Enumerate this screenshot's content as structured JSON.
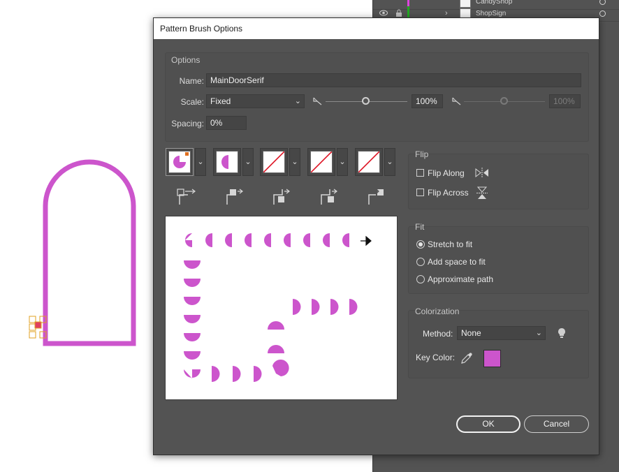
{
  "dialog": {
    "title": "Pattern Brush Options"
  },
  "options": {
    "group_label": "Options",
    "name_label": "Name:",
    "name_value": "MainDoorSerif",
    "scale_label": "Scale:",
    "scale_value": "Fixed",
    "scale_min": "100%",
    "scale_max": "100%",
    "spacing_label": "Spacing:",
    "spacing_value": "0%"
  },
  "tiles": [
    {
      "name": "side-tile",
      "selected": true
    },
    {
      "name": "outer-corner-tile",
      "selected": false
    },
    {
      "name": "inner-corner-tile",
      "selected": false
    },
    {
      "name": "start-tile",
      "selected": false
    },
    {
      "name": "end-tile",
      "selected": false
    }
  ],
  "flip": {
    "group_label": "Flip",
    "along_label": "Flip Along",
    "across_label": "Flip Across",
    "along_checked": false,
    "across_checked": false
  },
  "fit": {
    "group_label": "Fit",
    "options": [
      "Stretch to fit",
      "Add space to fit",
      "Approximate path"
    ],
    "selected": "Stretch to fit"
  },
  "colorization": {
    "group_label": "Colorization",
    "method_label": "Method:",
    "method_value": "None",
    "key_color_label": "Key Color:",
    "key_color": "#cc55cc"
  },
  "buttons": {
    "ok": "OK",
    "cancel": "Cancel"
  },
  "layers": [
    {
      "name": "CandyShop",
      "color": "#dd44dd"
    },
    {
      "name": "ShopSign",
      "color": "#22aa22"
    }
  ],
  "colors": {
    "accent": "#cc55cc",
    "panel": "#535353"
  }
}
